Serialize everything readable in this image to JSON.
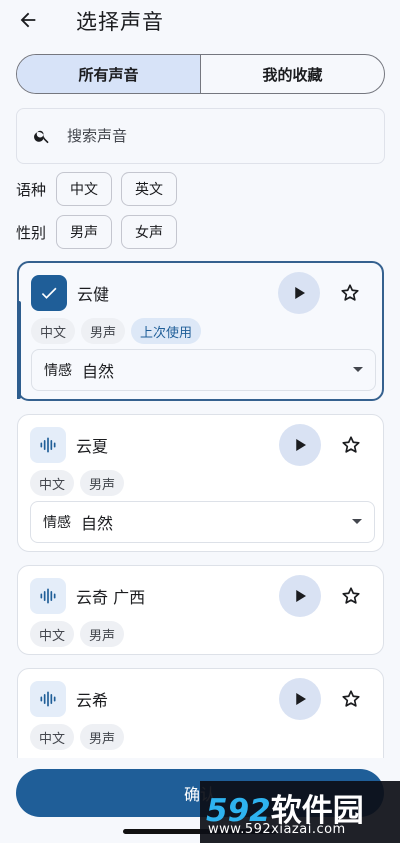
{
  "header": {
    "title": "选择声音",
    "back_icon": "arrow-left-icon"
  },
  "tabs": [
    {
      "label": "所有声音",
      "active": true
    },
    {
      "label": "我的收藏",
      "active": false
    }
  ],
  "search": {
    "placeholder": "搜索声音",
    "value": ""
  },
  "filters": {
    "language": {
      "label": "语种",
      "options": [
        "中文",
        "英文"
      ]
    },
    "gender": {
      "label": "性别",
      "options": [
        "男声",
        "女声"
      ]
    }
  },
  "voices": [
    {
      "name": "云健",
      "tags": [
        "中文",
        "男声"
      ],
      "accent_tag": "上次使用",
      "selected": true,
      "emotion_label": "情感",
      "emotion_value": "自然"
    },
    {
      "name": "云夏",
      "tags": [
        "中文",
        "男声"
      ],
      "selected": false,
      "emotion_label": "情感",
      "emotion_value": "自然"
    },
    {
      "name": "云奇 广西",
      "tags": [
        "中文",
        "男声"
      ],
      "selected": false
    },
    {
      "name": "云希",
      "tags": [
        "中文",
        "男声"
      ],
      "selected": false
    }
  ],
  "confirm": {
    "label": "确认"
  },
  "watermark": {
    "brand_num": "592",
    "brand_text": "软件园",
    "url": "www.592xiazai.com"
  },
  "colors": {
    "accent": "#1f5e98",
    "segment_active": "#d7e3f8",
    "play_bg": "#d9e2f3"
  }
}
